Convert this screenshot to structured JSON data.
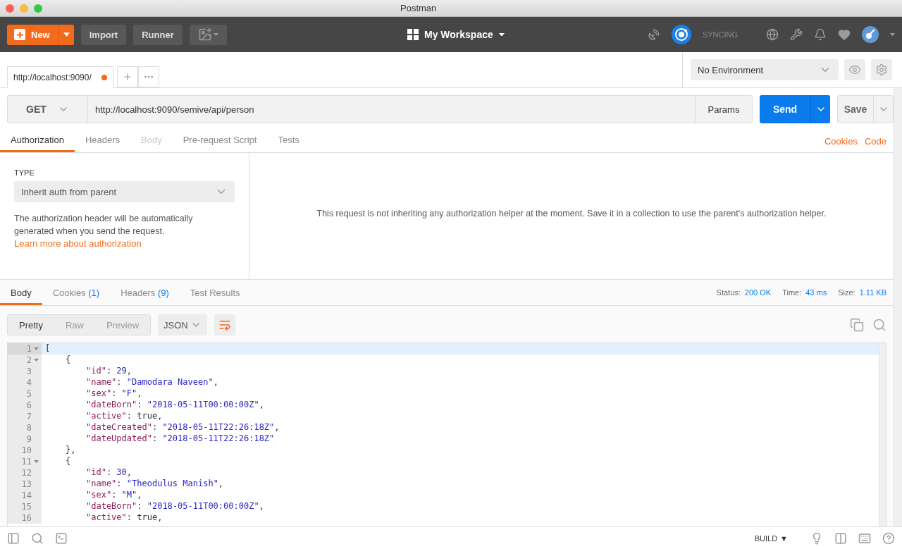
{
  "window": {
    "title": "Postman"
  },
  "toolbar": {
    "new_label": "New",
    "buttons": [
      "Import",
      "Runner"
    ],
    "workspace": "My Workspace",
    "sync_status": "SYNCING"
  },
  "tabs": [
    {
      "label": "http://localhost:9090/",
      "selected": true,
      "unsaved": true
    }
  ],
  "environment": {
    "value": "No Environment"
  },
  "request": {
    "method": "GET",
    "url": "http://localhost:9090/semive/api/person",
    "params": "Params",
    "send": "Send",
    "save": "Save"
  },
  "request_tabs": [
    {
      "label": "Authorization",
      "selected": true,
      "disabled": false
    },
    {
      "label": "Headers",
      "selected": false,
      "disabled": false
    },
    {
      "label": "Body",
      "selected": false,
      "disabled": true
    },
    {
      "label": "Pre-request Script",
      "selected": false,
      "disabled": false
    },
    {
      "label": "Tests",
      "selected": false,
      "disabled": false
    }
  ],
  "request_links": [
    "Cookies",
    "Code"
  ],
  "auth": {
    "type_label": "TYPE",
    "type_value": "Inherit auth from parent",
    "help": "The authorization header will be automatically generated when you send the request.",
    "help_link": "Learn more about authorization",
    "message": "This request is not inheriting any authorization helper at the moment. Save it in a collection to use the parent's authorization helper."
  },
  "response_tabs": [
    {
      "label": "Body",
      "selected": true
    },
    {
      "label": "Cookies",
      "count": "(1)",
      "selected": false
    },
    {
      "label": "Headers",
      "count": "(9)",
      "selected": false
    },
    {
      "label": "Test Results",
      "selected": false
    }
  ],
  "response_meta": [
    {
      "label": "Status:",
      "value": "200 OK"
    },
    {
      "label": "Time:",
      "value": "43 ms"
    },
    {
      "label": "Size:",
      "value": "1.11 KB"
    }
  ],
  "view_modes": [
    {
      "label": "Pretty",
      "selected": true
    },
    {
      "label": "Raw",
      "selected": false
    },
    {
      "label": "Preview",
      "selected": false
    }
  ],
  "format": "JSON",
  "code_lines": [
    {
      "number": "1",
      "foldable": true,
      "current": true,
      "tokens": [
        {
          "kind": "punct",
          "text": "["
        }
      ]
    },
    {
      "number": "2",
      "foldable": true,
      "current": false,
      "tokens": [
        {
          "kind": "punct",
          "text": "{"
        }
      ]
    },
    {
      "number": "3",
      "foldable": false,
      "current": false,
      "tokens": [
        {
          "kind": "key",
          "text": "\"id\""
        },
        {
          "kind": "punct",
          "text": ": "
        },
        {
          "kind": "number",
          "text": "29"
        },
        {
          "kind": "punct",
          "text": ","
        }
      ]
    },
    {
      "number": "4",
      "foldable": false,
      "current": false,
      "tokens": [
        {
          "kind": "key",
          "text": "\"name\""
        },
        {
          "kind": "punct",
          "text": ": "
        },
        {
          "kind": "string",
          "text": "\"Damodara Naveen\""
        },
        {
          "kind": "punct",
          "text": ","
        }
      ]
    },
    {
      "number": "5",
      "foldable": false,
      "current": false,
      "tokens": [
        {
          "kind": "key",
          "text": "\"sex\""
        },
        {
          "kind": "punct",
          "text": ": "
        },
        {
          "kind": "string",
          "text": "\"F\""
        },
        {
          "kind": "punct",
          "text": ","
        }
      ]
    },
    {
      "number": "6",
      "foldable": false,
      "current": false,
      "tokens": [
        {
          "kind": "key",
          "text": "\"dateBorn\""
        },
        {
          "kind": "punct",
          "text": ": "
        },
        {
          "kind": "string",
          "text": "\"2018-05-11T00:00:00Z\""
        },
        {
          "kind": "punct",
          "text": ","
        }
      ]
    },
    {
      "number": "7",
      "foldable": false,
      "current": false,
      "tokens": [
        {
          "kind": "key",
          "text": "\"active\""
        },
        {
          "kind": "punct",
          "text": ": true,"
        }
      ]
    },
    {
      "number": "8",
      "foldable": false,
      "current": false,
      "tokens": [
        {
          "kind": "key",
          "text": "\"dateCreated\""
        },
        {
          "kind": "punct",
          "text": ": "
        },
        {
          "kind": "string",
          "text": "\"2018-05-11T22:26:18Z\""
        },
        {
          "kind": "punct",
          "text": ","
        }
      ]
    },
    {
      "number": "9",
      "foldable": false,
      "current": false,
      "tokens": [
        {
          "kind": "key",
          "text": "\"dateUpdated\""
        },
        {
          "kind": "punct",
          "text": ": "
        },
        {
          "kind": "string",
          "text": "\"2018-05-11T22:26:18Z\""
        }
      ]
    },
    {
      "number": "10",
      "foldable": false,
      "current": false,
      "tokens": [
        {
          "kind": "punct",
          "text": "},"
        }
      ]
    },
    {
      "number": "11",
      "foldable": true,
      "current": false,
      "tokens": [
        {
          "kind": "punct",
          "text": "{"
        }
      ]
    },
    {
      "number": "12",
      "foldable": false,
      "current": false,
      "tokens": [
        {
          "kind": "key",
          "text": "\"id\""
        },
        {
          "kind": "punct",
          "text": ": "
        },
        {
          "kind": "number",
          "text": "30"
        },
        {
          "kind": "punct",
          "text": ","
        }
      ]
    },
    {
      "number": "13",
      "foldable": false,
      "current": false,
      "tokens": [
        {
          "kind": "key",
          "text": "\"name\""
        },
        {
          "kind": "punct",
          "text": ": "
        },
        {
          "kind": "string",
          "text": "\"Theodulus Manish\""
        },
        {
          "kind": "punct",
          "text": ","
        }
      ]
    },
    {
      "number": "14",
      "foldable": false,
      "current": false,
      "tokens": [
        {
          "kind": "key",
          "text": "\"sex\""
        },
        {
          "kind": "punct",
          "text": ": "
        },
        {
          "kind": "string",
          "text": "\"M\""
        },
        {
          "kind": "punct",
          "text": ","
        }
      ]
    },
    {
      "number": "15",
      "foldable": false,
      "current": false,
      "tokens": [
        {
          "kind": "key",
          "text": "\"dateBorn\""
        },
        {
          "kind": "punct",
          "text": ": "
        },
        {
          "kind": "string",
          "text": "\"2018-05-11T00:00:00Z\""
        },
        {
          "kind": "punct",
          "text": ","
        }
      ]
    },
    {
      "number": "16",
      "foldable": false,
      "current": false,
      "tokens": [
        {
          "kind": "key",
          "text": "\"active\""
        },
        {
          "kind": "punct",
          "text": ": true,"
        }
      ]
    }
  ],
  "footer": {
    "build_label": "BUILD",
    "build_caret": "▼"
  }
}
